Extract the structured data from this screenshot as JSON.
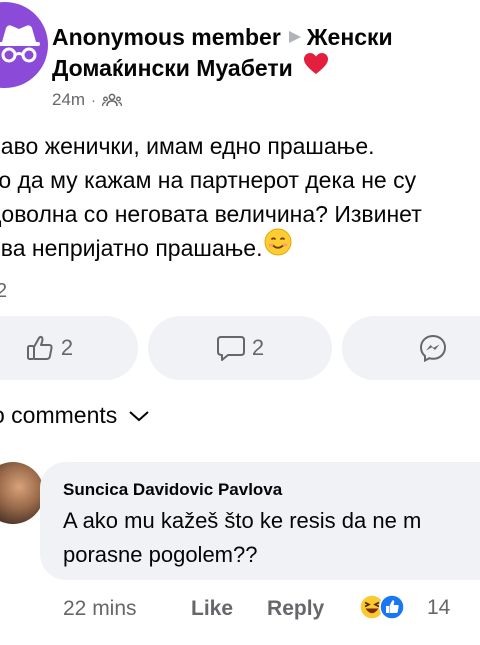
{
  "post": {
    "author": "Anonymous member",
    "group": "Женски Домаќински Муабети",
    "time": "24m",
    "audience_icon": "group-icon",
    "lines": [
      "раво женички, имам едно прашање.",
      "ко да му кажам на партнерот дека не су",
      "доволна со неговата величина? Извинет",
      "ова непријатно прашање."
    ],
    "emoji": "smiling-face-icon",
    "reaction_count": "2"
  },
  "actions": {
    "like_count": "2",
    "comment_count": "2",
    "share_icon": "messenger-icon"
  },
  "comments_header": {
    "label": "o comments",
    "icon": "chevron-down-icon"
  },
  "comment": {
    "author": "Suncica Davidovic Pavlova",
    "line1": "A ako mu kažeš što ke resis da ne m",
    "line2": "porasne pogolem??",
    "time": "22 mins",
    "like_label": "Like",
    "reply_label": "Reply",
    "reaction_count": "14"
  },
  "colors": {
    "avatar_bg": "#8b4bd8",
    "heart": "#e41e3f",
    "pill_bg": "#f0f2f5",
    "secondary_text": "#65676b",
    "like_blue": "#1877f2"
  }
}
